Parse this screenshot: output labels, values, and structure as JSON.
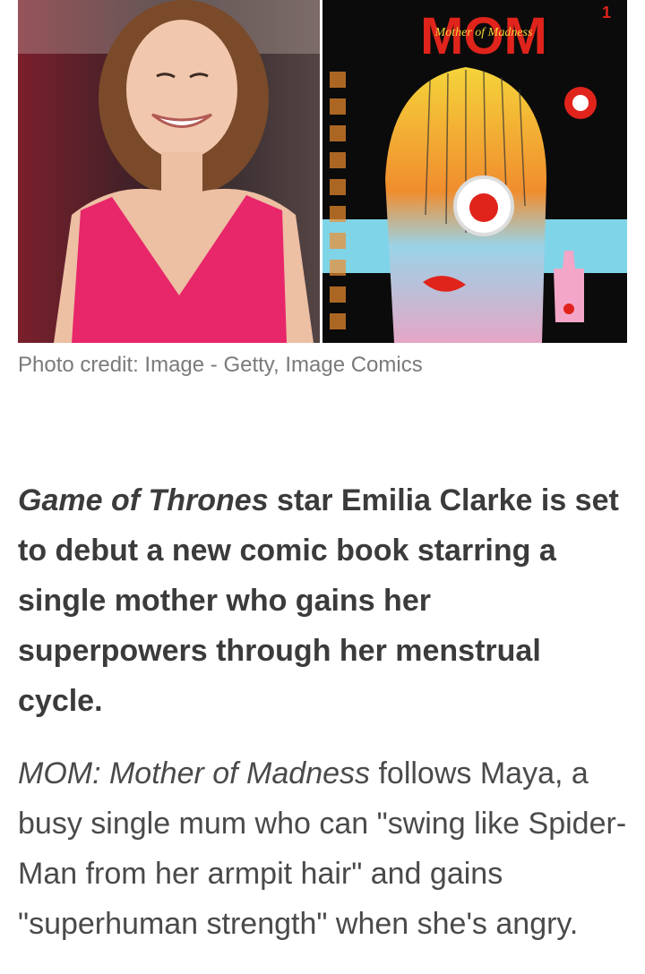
{
  "images": {
    "left_alt": "Photo of a smiling woman in a pink dress",
    "right_title": "MOM",
    "right_subtitle": "Mother of Madness",
    "right_issue": "1"
  },
  "caption": "Photo credit: Image - Getty, Image Comics",
  "lead": {
    "title_italic": "Game of Thrones",
    "text": " star Emilia Clarke is set to debut a new comic book starring a single mother who gains her superpowers through her menstrual cycle."
  },
  "body": {
    "title_italic": "MOM: Mother of Madness",
    "text": " follows Maya, a busy single mum who can \"swing like Spider-Man from her armpit hair\" and gains \"superhuman strength\" when she's angry."
  }
}
